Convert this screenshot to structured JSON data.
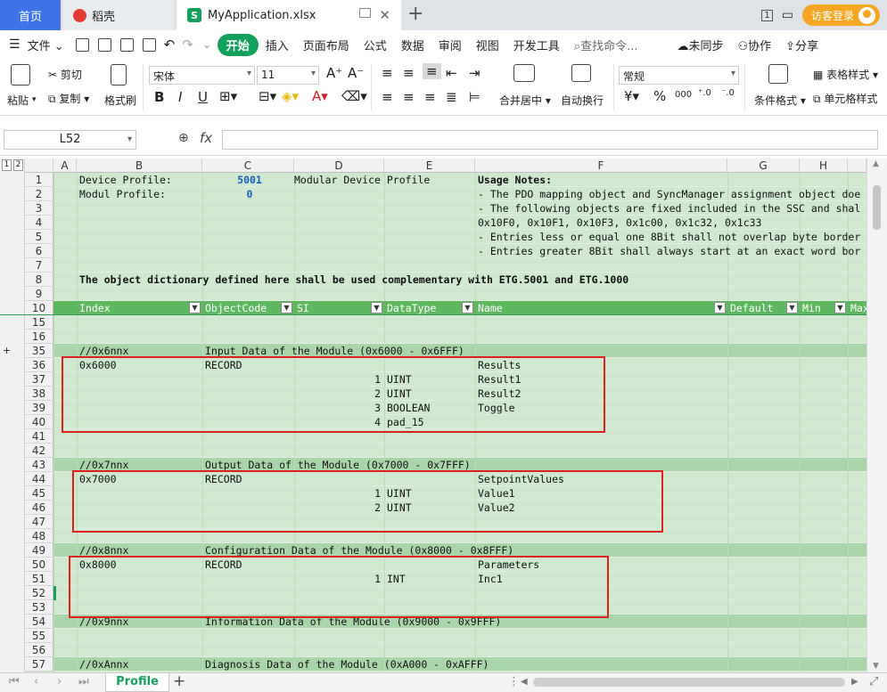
{
  "tabs": {
    "home": "首页",
    "daoke": "稻壳",
    "file": "MyApplication.xlsx",
    "file_badge": "S"
  },
  "window": {
    "badge": "1",
    "login": "访客登录"
  },
  "menu": {
    "file": "文件",
    "items": [
      "开始",
      "插入",
      "页面布局",
      "公式",
      "数据",
      "审阅",
      "视图",
      "开发工具"
    ],
    "search_placeholder": "查找命令...",
    "unsync": "未同步",
    "collab": "协作",
    "share": "分享"
  },
  "ribbon": {
    "paste": "粘贴",
    "cut": "剪切",
    "copy": "复制",
    "format_painter": "格式刷",
    "font": "宋体",
    "size": "11",
    "merge": "合并居中",
    "wrap": "自动换行",
    "numfmt": "常规",
    "cond": "条件格式",
    "table_style": "表格样式",
    "cell_style": "单元格样式"
  },
  "formula_bar": {
    "namebox": "L52",
    "fx": "fx",
    "value": ""
  },
  "columns": [
    "A",
    "B",
    "C",
    "D",
    "E",
    "F",
    "G",
    "H"
  ],
  "outline_levels": [
    "1",
    "2"
  ],
  "rows": [
    {
      "n": "1",
      "cells": {
        "B": "Device Profile:",
        "C": "5001",
        "D": "Modular Device Profile",
        "F": "Usage Notes:"
      }
    },
    {
      "n": "2",
      "cells": {
        "B": "Modul Profile:",
        "C": "0",
        "F": "- The PDO mapping object and SyncManager assignment object doe"
      }
    },
    {
      "n": "3",
      "cells": {
        "F": "- The following objects are fixed included in the SSC and shal"
      }
    },
    {
      "n": "4",
      "cells": {
        "F": "0x10F0, 0x10F1, 0x10F3, 0x1c00, 0x1c32, 0x1c33"
      }
    },
    {
      "n": "5",
      "cells": {
        "F": "- Entries less or equal one 8Bit shall not overlap byte border"
      }
    },
    {
      "n": "6",
      "cells": {
        "F": "- Entries greater 8Bit shall always start at an exact word bor"
      }
    },
    {
      "n": "7",
      "cells": {}
    },
    {
      "n": "8",
      "cells": {
        "B": "The object dictionary defined here shall be used complementary with ETG.5001 and ETG.1000"
      }
    },
    {
      "n": "9",
      "cells": {}
    },
    {
      "n": "10",
      "header": true,
      "cells": {
        "B": "Index",
        "C": "ObjectCode",
        "D": "SI",
        "E": "DataType",
        "F": "Name",
        "G": "Default",
        "H": "Min",
        "I": "Max"
      }
    },
    {
      "n": "15",
      "cells": {}
    },
    {
      "n": "16",
      "cells": {}
    },
    {
      "n": "35",
      "section": true,
      "cells": {
        "B": "//0x6nnx",
        "C": "Input Data of the Module (0x6000 - 0x6FFF)"
      }
    },
    {
      "n": "36",
      "cells": {
        "B": "0x6000",
        "C": "RECORD",
        "F": "Results"
      }
    },
    {
      "n": "37",
      "cells": {
        "D": "1",
        "E": "UINT",
        "F": "Result1"
      }
    },
    {
      "n": "38",
      "cells": {
        "D": "2",
        "E": "UINT",
        "F": "Result2"
      }
    },
    {
      "n": "39",
      "cells": {
        "D": "3",
        "E": "BOOLEAN",
        "F": "Toggle"
      }
    },
    {
      "n": "40",
      "cells": {
        "D": "4",
        "E": "pad_15"
      }
    },
    {
      "n": "41",
      "cells": {}
    },
    {
      "n": "42",
      "cells": {}
    },
    {
      "n": "43",
      "section": true,
      "cells": {
        "B": "//0x7nnx",
        "C": "Output Data of the Module (0x7000 - 0x7FFF)"
      }
    },
    {
      "n": "44",
      "cells": {
        "B": "0x7000",
        "C": "RECORD",
        "F": "SetpointValues"
      }
    },
    {
      "n": "45",
      "cells": {
        "D": "1",
        "E": "UINT",
        "F": "Value1"
      }
    },
    {
      "n": "46",
      "cells": {
        "D": "2",
        "E": "UINT",
        "F": "Value2"
      }
    },
    {
      "n": "47",
      "cells": {}
    },
    {
      "n": "48",
      "cells": {}
    },
    {
      "n": "49",
      "section": true,
      "cells": {
        "B": "//0x8nnx",
        "C": "Configuration Data of the Module (0x8000 - 0x8FFF)"
      }
    },
    {
      "n": "50",
      "cells": {
        "B": "0x8000",
        "C": "RECORD",
        "F": "Parameters"
      }
    },
    {
      "n": "51",
      "cells": {
        "D": "1",
        "E": "INT",
        "F": "Inc1"
      }
    },
    {
      "n": "52",
      "cells": {}
    },
    {
      "n": "53",
      "cells": {}
    },
    {
      "n": "54",
      "section": true,
      "cells": {
        "B": "//0x9nnx",
        "C": "Information Data of the Module (0x9000 - 0x9FFF)"
      }
    },
    {
      "n": "55",
      "cells": {}
    },
    {
      "n": "56",
      "cells": {}
    },
    {
      "n": "57",
      "section": true,
      "cells": {
        "B": "//0xAnnx",
        "C": "Diagnosis Data of the Module (0xA000 - 0xAFFF)"
      }
    }
  ],
  "sheet": {
    "name": "Profile"
  }
}
